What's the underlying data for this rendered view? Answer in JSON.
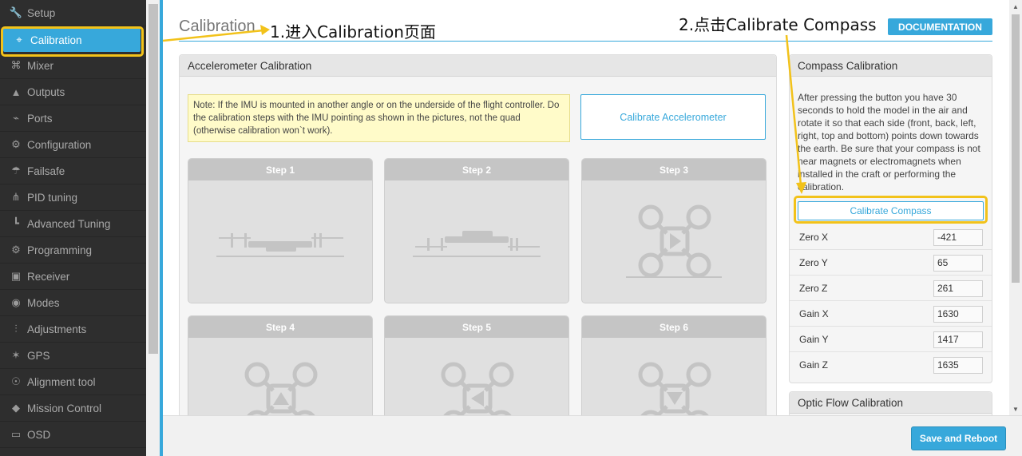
{
  "sidebar": {
    "items": [
      {
        "label": "Setup",
        "icon": "wrench-icon"
      },
      {
        "label": "Calibration",
        "icon": "crosshair-icon",
        "active": true
      },
      {
        "label": "Mixer",
        "icon": "mixer-icon"
      },
      {
        "label": "Outputs",
        "icon": "outputs-icon"
      },
      {
        "label": "Ports",
        "icon": "plug-icon"
      },
      {
        "label": "Configuration",
        "icon": "gear-icon"
      },
      {
        "label": "Failsafe",
        "icon": "parachute-icon"
      },
      {
        "label": "PID tuning",
        "icon": "sitemap-icon"
      },
      {
        "label": "Advanced Tuning",
        "icon": "tree-icon"
      },
      {
        "label": "Programming",
        "icon": "gear-icon"
      },
      {
        "label": "Receiver",
        "icon": "receiver-icon"
      },
      {
        "label": "Modes",
        "icon": "toggle-icon"
      },
      {
        "label": "Adjustments",
        "icon": "sliders-icon"
      },
      {
        "label": "GPS",
        "icon": "satellite-icon"
      },
      {
        "label": "Alignment tool",
        "icon": "compass-icon"
      },
      {
        "label": "Mission Control",
        "icon": "map-pin-icon"
      },
      {
        "label": "OSD",
        "icon": "osd-icon"
      }
    ]
  },
  "header": {
    "title": "Calibration",
    "documentation": "DOCUMENTATION"
  },
  "accel": {
    "title": "Accelerometer Calibration",
    "note": "Note: If the IMU is mounted in another angle or on the underside of the flight controller. Do the calibration steps with the IMU pointing as shown in the pictures, not the quad (otherwise calibration won`t work).",
    "button": "Calibrate Accelerometer",
    "steps": [
      "Step 1",
      "Step 2",
      "Step 3",
      "Step 4",
      "Step 5",
      "Step 6"
    ]
  },
  "compass": {
    "title": "Compass Calibration",
    "description": "After pressing the button you have 30 seconds to hold the model in the air and rotate it so that each side (front, back, left, right, top and bottom) points down towards the earth. Be sure that your compass is not near magnets or electromagnets when installed in the craft or performing the calibration.",
    "button": "Calibrate Compass",
    "fields": [
      {
        "label": "Zero X",
        "value": "-421"
      },
      {
        "label": "Zero Y",
        "value": "65"
      },
      {
        "label": "Zero Z",
        "value": "261"
      },
      {
        "label": "Gain X",
        "value": "1630"
      },
      {
        "label": "Gain Y",
        "value": "1417"
      },
      {
        "label": "Gain Z",
        "value": "1635"
      }
    ]
  },
  "optic_flow": {
    "title": "Optic Flow Calibration"
  },
  "footer": {
    "save_reboot": "Save and Reboot"
  },
  "annotations": {
    "step1": "1.进入Calibration页面",
    "step2": "2.点击Calibrate Compass",
    "color": "#f2c21a"
  },
  "colors": {
    "accent": "#37a8db",
    "sidebar_bg": "#2e2e2e",
    "note_bg": "#fffbc9"
  }
}
